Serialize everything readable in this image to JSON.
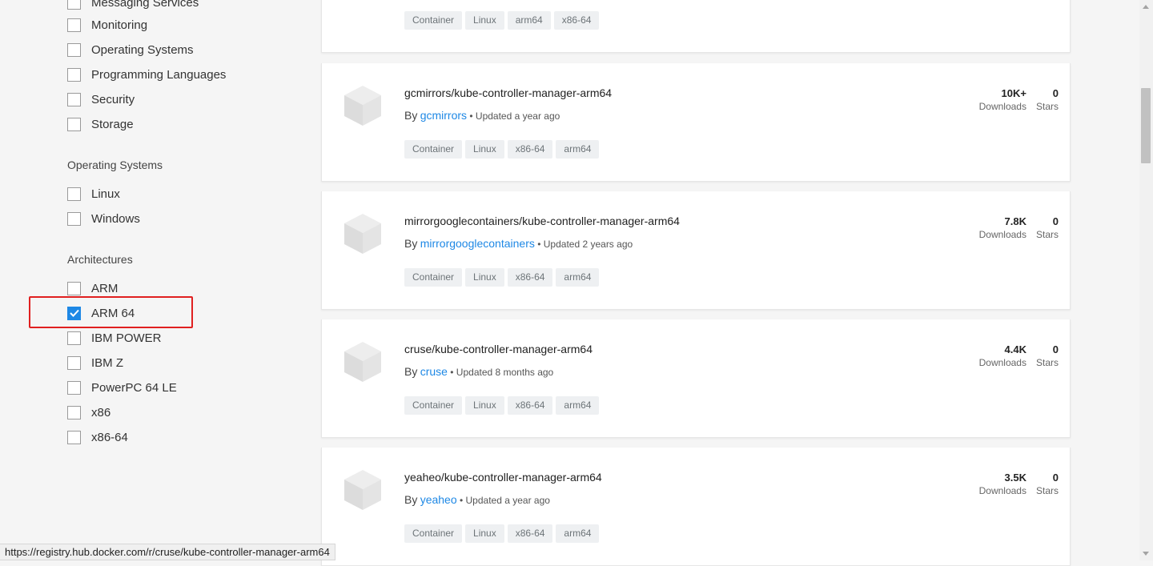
{
  "sidebar": {
    "categories": [
      {
        "label": "Messaging Services",
        "checked": false
      },
      {
        "label": "Monitoring",
        "checked": false
      },
      {
        "label": "Operating Systems",
        "checked": false
      },
      {
        "label": "Programming Languages",
        "checked": false
      },
      {
        "label": "Security",
        "checked": false
      },
      {
        "label": "Storage",
        "checked": false
      }
    ],
    "os_title": "Operating Systems",
    "os": [
      {
        "label": "Linux",
        "checked": false
      },
      {
        "label": "Windows",
        "checked": false
      }
    ],
    "arch_title": "Architectures",
    "arch": [
      {
        "label": "ARM",
        "checked": false
      },
      {
        "label": "ARM 64",
        "checked": true
      },
      {
        "label": "IBM POWER",
        "checked": false
      },
      {
        "label": "IBM Z",
        "checked": false
      },
      {
        "label": "PowerPC 64 LE",
        "checked": false
      },
      {
        "label": "x86",
        "checked": false
      },
      {
        "label": "x86-64",
        "checked": false
      }
    ]
  },
  "results": [
    {
      "tags": [
        "Container",
        "Linux",
        "arm64",
        "x86-64"
      ]
    },
    {
      "name": "gcmirrors/kube-controller-manager-arm64",
      "by": "By",
      "publisher": "gcmirrors",
      "updated": "• Updated a year ago",
      "tags": [
        "Container",
        "Linux",
        "x86-64",
        "arm64"
      ],
      "downloads": "10K+",
      "downloads_label": "Downloads",
      "stars": "0",
      "stars_label": "Stars"
    },
    {
      "name": "mirrorgooglecontainers/kube-controller-manager-arm64",
      "by": "By",
      "publisher": "mirrorgooglecontainers",
      "updated": "• Updated 2 years ago",
      "tags": [
        "Container",
        "Linux",
        "x86-64",
        "arm64"
      ],
      "downloads": "7.8K",
      "downloads_label": "Downloads",
      "stars": "0",
      "stars_label": "Stars"
    },
    {
      "name": "cruse/kube-controller-manager-arm64",
      "by": "By",
      "publisher": "cruse",
      "updated": "• Updated 8 months ago",
      "tags": [
        "Container",
        "Linux",
        "x86-64",
        "arm64"
      ],
      "downloads": "4.4K",
      "downloads_label": "Downloads",
      "stars": "0",
      "stars_label": "Stars"
    },
    {
      "name": "yeaheo/kube-controller-manager-arm64",
      "by": "By",
      "publisher": "yeaheo",
      "updated": "• Updated a year ago",
      "tags": [
        "Container",
        "Linux",
        "x86-64",
        "arm64"
      ],
      "downloads": "3.5K",
      "downloads_label": "Downloads",
      "stars": "0",
      "stars_label": "Stars"
    }
  ],
  "status_url": "https://registry.hub.docker.com/r/cruse/kube-controller-manager-arm64",
  "colors": {
    "accent": "#1e88e5",
    "highlight": "#e02020"
  }
}
